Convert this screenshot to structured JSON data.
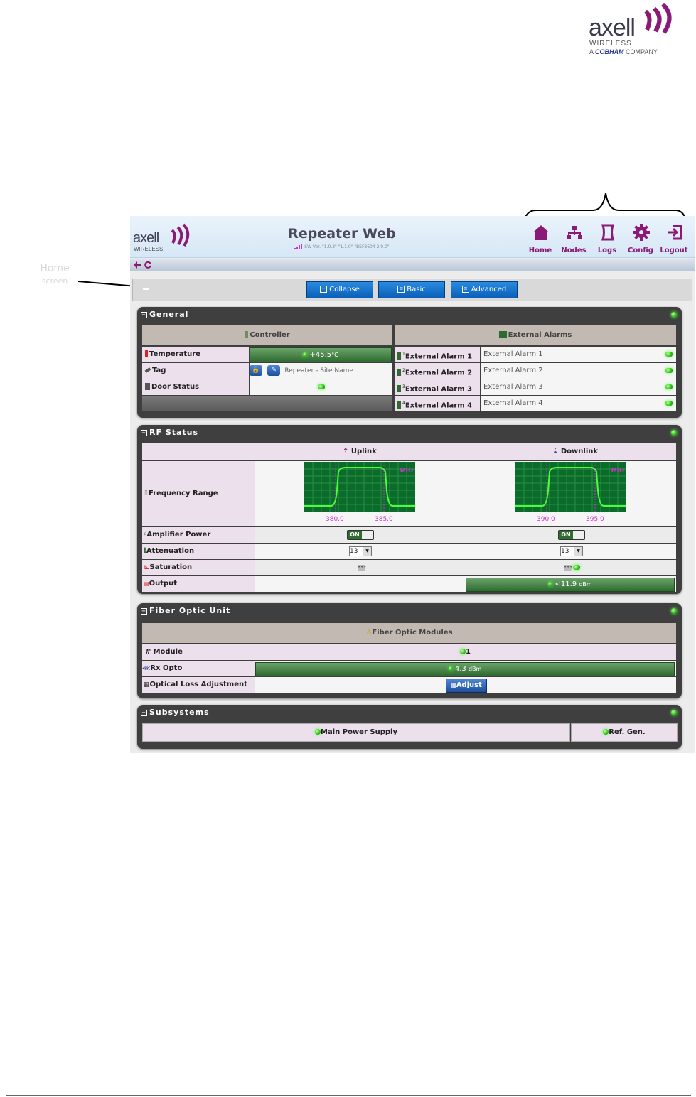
{
  "doc_header": {
    "logo_word": "axell",
    "logo_sub": "WIRELESS",
    "logo_sub2_prefix": "A",
    "logo_brand": "COBHAM",
    "logo_sub2_suffix": "COMPANY"
  },
  "callout": {
    "label_line1": "Home",
    "label_line2": "screen"
  },
  "app": {
    "logo_word": "axell",
    "logo_sub": "WIRELESS",
    "title": "Repeater Web",
    "version": "SW Ver. \"1.0.3\" \"1.1.0\" \"BSF3604 2.0.0\"",
    "nav": [
      {
        "label": "Home",
        "icon": "home-icon"
      },
      {
        "label": "Nodes",
        "icon": "nodes-icon"
      },
      {
        "label": "Logs",
        "icon": "logs-icon"
      },
      {
        "label": "Config",
        "icon": "gear-icon"
      },
      {
        "label": "Logout",
        "icon": "logout-icon"
      }
    ],
    "toolbar": {
      "collapse": "Collapse",
      "basic": "Basic",
      "advanced": "Advanced"
    }
  },
  "general": {
    "title": "General",
    "controller_header": "Controller",
    "alarms_header": "External Alarms",
    "temperature_label": "Temperature",
    "temperature_value": "+45.5",
    "temperature_unit": "°C",
    "tag_label": "Tag",
    "tag_value": "Repeater - Site Name",
    "door_label": "Door Status",
    "alarms": [
      {
        "label": "External Alarm 1",
        "value": "External Alarm 1",
        "num": "1"
      },
      {
        "label": "External Alarm 2",
        "value": "External Alarm 2",
        "num": "2"
      },
      {
        "label": "External Alarm 3",
        "value": "External Alarm 3",
        "num": "3"
      },
      {
        "label": "External Alarm 4",
        "value": "External Alarm 4",
        "num": "4"
      }
    ]
  },
  "rf": {
    "title": "RF Status",
    "uplink": "Uplink",
    "downlink": "Downlink",
    "freq_label": "Frequency Range",
    "mhz": "MHz",
    "up_low": "380.0",
    "up_high": "385.0",
    "down_low": "390.0",
    "down_high": "395.0",
    "amp_label": "Amplifier Power",
    "on": "ON",
    "atten_label": "Attenuation",
    "atten_up": "13",
    "atten_down": "13",
    "sat_label": "Saturation",
    "output_label": "Output",
    "output_value": "<11.9",
    "output_unit": "dBm",
    "dots": "•••"
  },
  "fiber": {
    "title": "Fiber Optic Unit",
    "header": "Fiber Optic Modules",
    "module_label": "Module",
    "module_value": "1",
    "rx_label": "Rx Opto",
    "rx_value": "4.3",
    "rx_unit": "dBm",
    "ola_label": "Optical Loss Adjustment",
    "adjust": "Adjust"
  },
  "subsystems": {
    "title": "Subsystems",
    "main_power": "Main Power Supply",
    "ref_gen": "Ref. Gen."
  },
  "colors": {
    "nav_accent": "#8b1a77",
    "button_blue": "#0a5fb9",
    "led_green": "#2ec01a",
    "graph_bg": "#0b6b2a",
    "marker_magenta": "#cc33cc"
  }
}
